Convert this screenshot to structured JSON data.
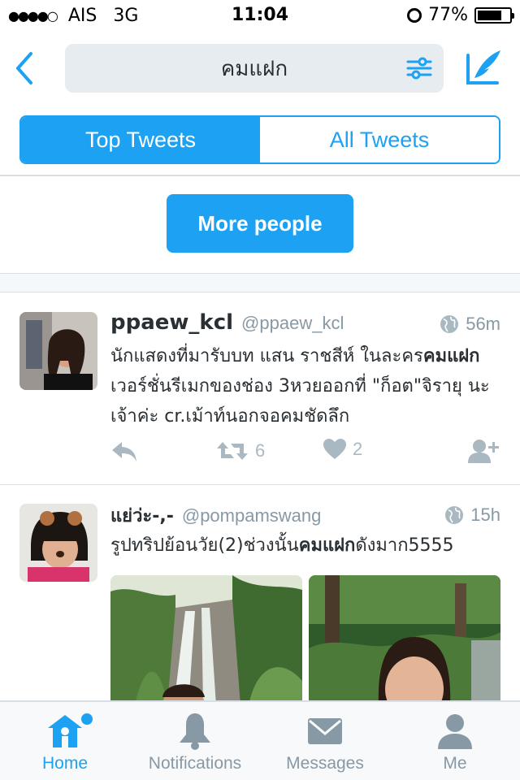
{
  "status_bar": {
    "signal": "●●●●○",
    "carrier": "AIS",
    "network": "3G",
    "time": "11:04",
    "battery_percent": "77%",
    "battery_level": 0.77
  },
  "header": {
    "back_icon": "chevron-left-icon",
    "search_query": "คมแฝก",
    "filter_icon": "sliders-icon",
    "compose_icon": "compose-quill-icon"
  },
  "tabs": {
    "top_label": "Top Tweets",
    "all_label": "All Tweets",
    "selected": "Top Tweets"
  },
  "more_people_label": "More people",
  "tweets": [
    {
      "name": "ppaew_kcl",
      "handle": "@ppaew_kcl",
      "time": "56m",
      "text_before": "นักแสดงที่มารับบท แสน ราชสีห์ ในละคร",
      "text_bold": "คมแฝก",
      "text_after": " เวอร์ชั่นรีเมกของช่อง 3หวยออกที่ \"ก็อต\"จิรายุ นะเจ้าค่ะ cr.เม้าท์นอกจอคมชัดลึก",
      "retweets": "6",
      "likes": "2"
    },
    {
      "name": "แย่ว่ะ-,-",
      "handle": "@pompamswang",
      "time": "15h",
      "text_before": "รูปทริปย้อนวัย(2)ช่วงนั้น",
      "text_bold": "คมแฝก",
      "text_after": "ดังมาก5555"
    }
  ],
  "tab_bar": {
    "home": "Home",
    "notifications": "Notifications",
    "messages": "Messages",
    "me": "Me"
  },
  "colors": {
    "accent": "#1da1f2",
    "muted": "#8899a6",
    "text": "#292f33"
  }
}
